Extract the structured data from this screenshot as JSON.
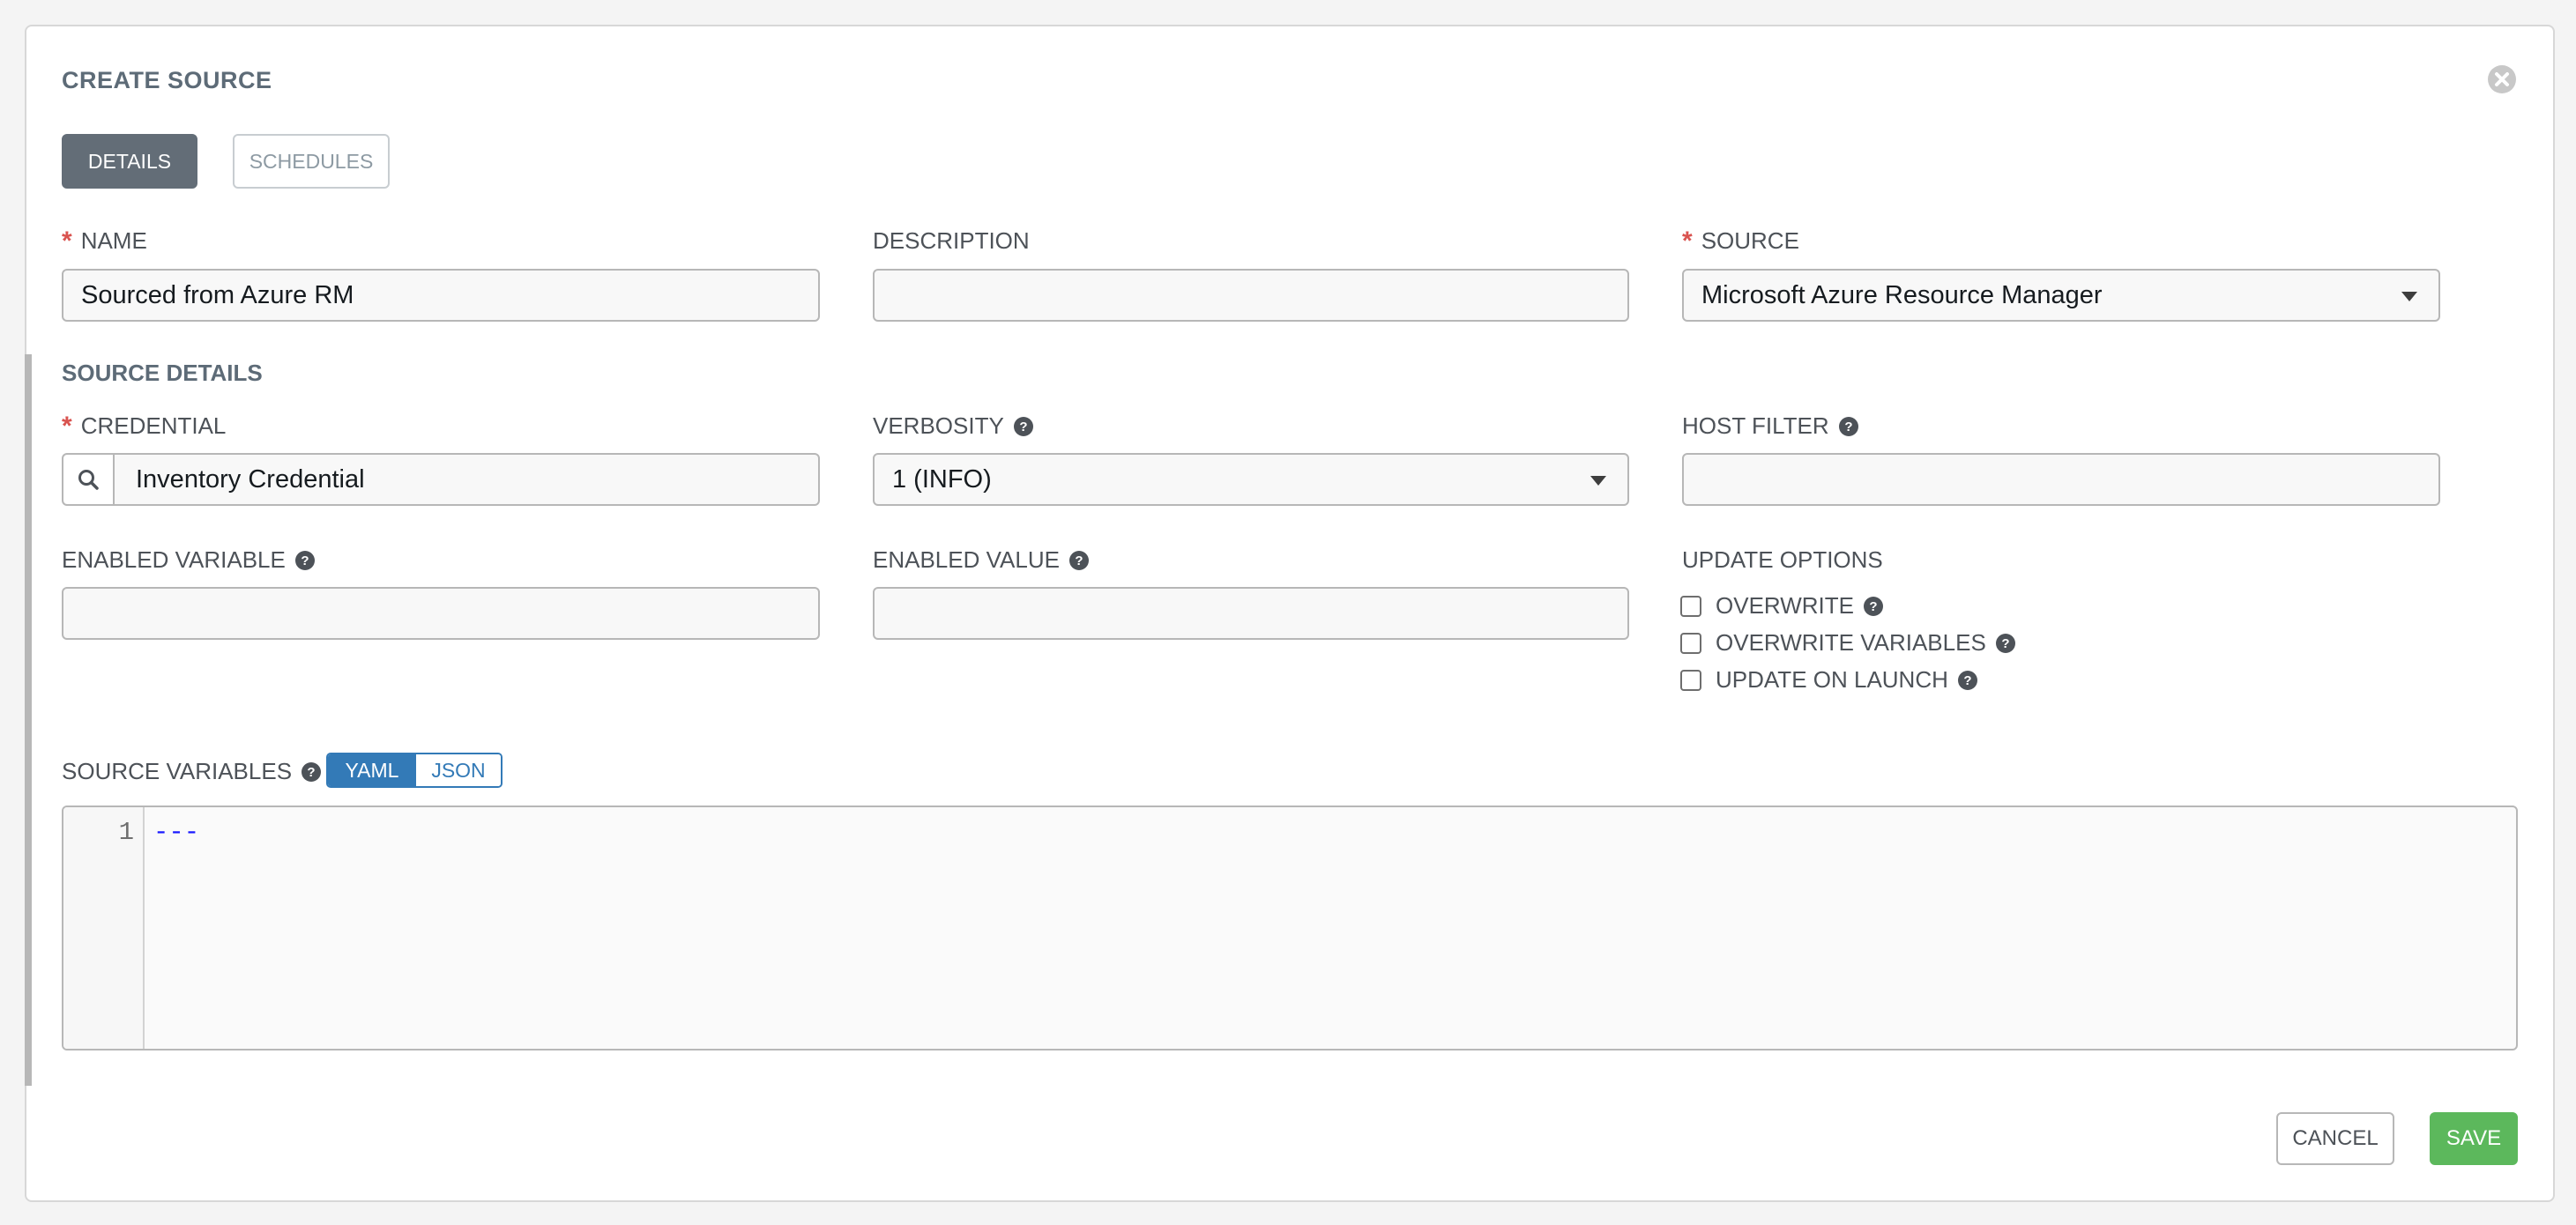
{
  "modal": {
    "title": "CREATE SOURCE"
  },
  "tabs": [
    {
      "label": "DETAILS",
      "active": true
    },
    {
      "label": "SCHEDULES",
      "active": false
    }
  ],
  "fields": {
    "name": {
      "label": "NAME",
      "required": true,
      "value": "Sourced from Azure RM"
    },
    "description": {
      "label": "DESCRIPTION",
      "required": false,
      "value": ""
    },
    "source": {
      "label": "SOURCE",
      "required": true,
      "value": "Microsoft Azure Resource Manager"
    }
  },
  "source_details": {
    "heading": "SOURCE DETAILS",
    "credential": {
      "label": "CREDENTIAL",
      "required": true,
      "value": "Inventory Credential"
    },
    "verbosity": {
      "label": "VERBOSITY",
      "value": "1 (INFO)"
    },
    "host_filter": {
      "label": "HOST FILTER",
      "value": ""
    },
    "enabled_variable": {
      "label": "ENABLED VARIABLE",
      "value": ""
    },
    "enabled_value": {
      "label": "ENABLED VALUE",
      "value": ""
    },
    "update_options": {
      "label": "UPDATE OPTIONS",
      "options": [
        {
          "label": "OVERWRITE",
          "checked": false
        },
        {
          "label": "OVERWRITE VARIABLES",
          "checked": false
        },
        {
          "label": "UPDATE ON LAUNCH",
          "checked": false
        }
      ]
    },
    "source_variables": {
      "label": "SOURCE VARIABLES",
      "modes": [
        "YAML",
        "JSON"
      ],
      "active_mode": "YAML",
      "line_number": "1",
      "content": "---"
    }
  },
  "footer": {
    "cancel_label": "CANCEL",
    "save_label": "SAVE"
  },
  "colors": {
    "primary_blue": "#337ab7",
    "save_green": "#5cb85c",
    "required_red": "#d9534f",
    "tab_active": "#636d77"
  }
}
